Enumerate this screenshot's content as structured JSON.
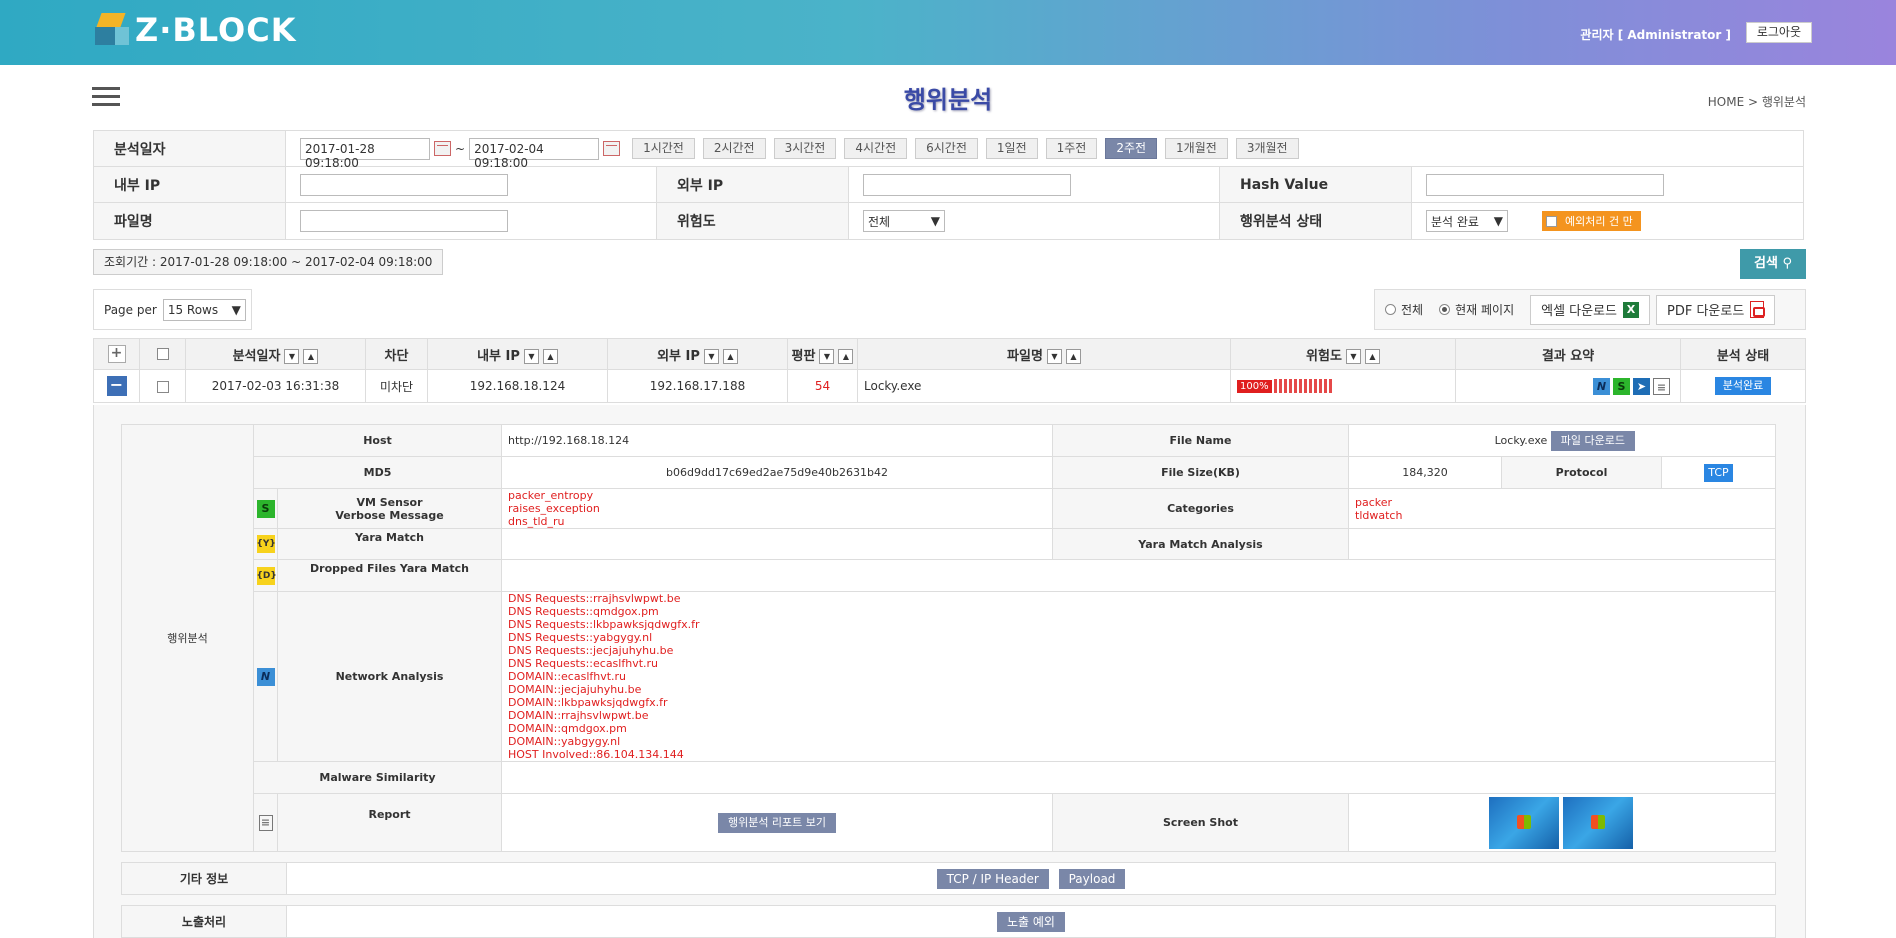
{
  "header": {
    "logo_text": "Z·BLOCK",
    "admin_label": "관리자 [ Administrator ]",
    "logout_label": "로그아웃"
  },
  "page": {
    "title": "행위분석",
    "breadcrumb": "HOME > 행위분석"
  },
  "search": {
    "date_label": "분석일자",
    "date_from": "2017-01-28 09:18:00",
    "date_to": "2017-02-04 09:18:00",
    "tilde": "~",
    "quick_ranges": [
      "1시간전",
      "2시간전",
      "3시간전",
      "4시간전",
      "6시간전",
      "1일전",
      "1주전",
      "2주전",
      "1개월전",
      "3개월전"
    ],
    "active_range": "2주전",
    "internal_ip_label": "내부 IP",
    "external_ip_label": "외부 IP",
    "hash_label": "Hash Value",
    "filename_label": "파일명",
    "risk_label": "위험도",
    "risk_value": "전체",
    "status_label": "행위분석 상태",
    "status_value": "분석 완료",
    "exception_label": "예외처리 건 만",
    "period_text": "조회기간 : 2017-01-28 09:18:00 ~ 2017-02-04 09:18:00",
    "search_button": "검색"
  },
  "list": {
    "page_per_label": "Page per",
    "page_per_value": "15 Rows",
    "radio_all": "전체",
    "radio_current": "현재 페이지",
    "excel_button": "엑셀 다운로드",
    "pdf_button": "PDF 다운로드",
    "columns": [
      "분석일자",
      "차단",
      "내부 IP",
      "외부 IP",
      "평판",
      "파일명",
      "위험도",
      "결과 요약",
      "분석 상태"
    ],
    "row": {
      "date": "2017-02-03 16:31:38",
      "block": "미차단",
      "internal_ip": "192.168.18.124",
      "external_ip": "192.168.17.188",
      "reputation": "54",
      "filename": "Locky.exe",
      "risk_pct": "100%",
      "risk_level": 1.0,
      "status": "분석완료"
    }
  },
  "detail": {
    "section_label": "행위분석",
    "host_label": "Host",
    "host_value": "http://192.168.18.124",
    "file_name_label": "File Name",
    "file_name_value": "Locky.exe",
    "file_download": "파일 다운로드",
    "md5_label": "MD5",
    "md5_value": "b06d9dd17c69ed2ae75d9e40b2631b42",
    "file_size_label": "File Size(KB)",
    "file_size_value": "184,320",
    "protocol_label": "Protocol",
    "protocol_value": "TCP",
    "vm_label_1": "VM Sensor",
    "vm_label_2": "Verbose Message",
    "vm_messages": [
      "packer_entropy",
      "raises_exception",
      "dns_tld_ru"
    ],
    "categories_label": "Categories",
    "categories": [
      "packer",
      "tldwatch"
    ],
    "yara_label": "Yara Match",
    "yara_analysis_label": "Yara Match Analysis",
    "dropped_label": "Dropped Files Yara Match",
    "network_label": "Network Analysis",
    "network_lines": [
      "DNS Requests::rrajhsvlwpwt.be",
      "DNS Requests::qmdgox.pm",
      "DNS Requests::lkbpawksjqdwgfx.fr",
      "DNS Requests::yabgygy.nl",
      "DNS Requests::jecjajuhyhu.be",
      "DNS Requests::ecaslfhvt.ru",
      "DOMAIN::ecaslfhvt.ru",
      "DOMAIN::jecjajuhyhu.be",
      "DOMAIN::lkbpawksjqdwgfx.fr",
      "DOMAIN::rrajhsvlwpwt.be",
      "DOMAIN::qmdgox.pm",
      "DOMAIN::yabgygy.nl",
      "HOST Involved::86.104.134.144"
    ],
    "malware_label": "Malware Similarity",
    "report_label": "Report",
    "report_button": "행위분석 리포트 보기",
    "screenshot_label": "Screen Shot"
  },
  "other": {
    "label": "기타 정보",
    "tcp_button": "TCP / IP Header",
    "payload_button": "Payload"
  },
  "exposure": {
    "label": "노출처리",
    "button": "노출 예외"
  }
}
